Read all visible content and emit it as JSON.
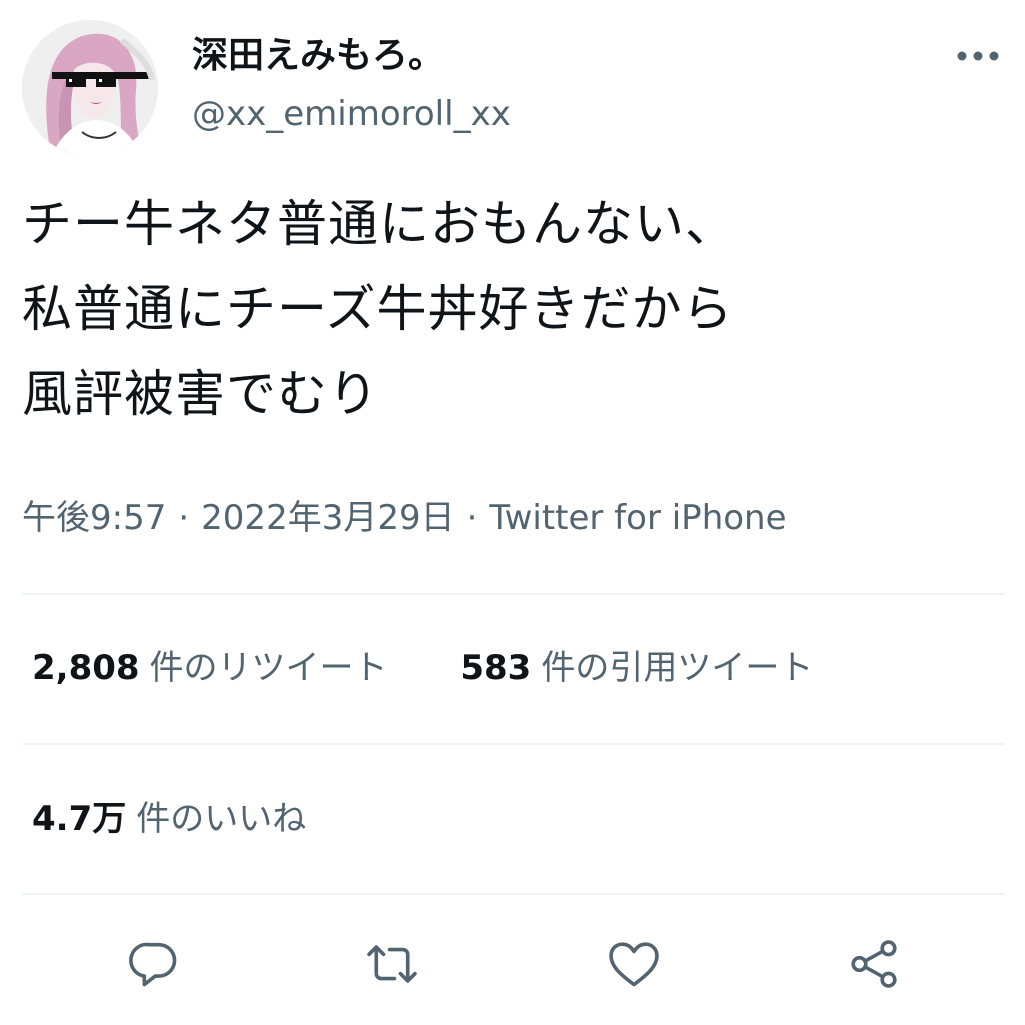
{
  "author": {
    "display_name": "深田えみもろ。",
    "handle": "@xx_emimoroll_xx",
    "avatar_icon": "profile-avatar"
  },
  "more_icon": "more-horizontal-icon",
  "tweet": {
    "lines": [
      "チー牛ネタ普通におもんない、",
      "私普通にチーズ牛丼好きだから",
      "風評被害でむり"
    ]
  },
  "meta": {
    "time": "午後9:57",
    "date": "2022年3月29日",
    "source": "Twitter for iPhone",
    "separator": "·"
  },
  "stats": {
    "retweets": {
      "count": "2,808",
      "label": "件のリツイート"
    },
    "quotes": {
      "count": "583",
      "label": "件の引用ツイート"
    },
    "likes": {
      "count": "4.7万",
      "label": "件のいいね"
    }
  },
  "actions": {
    "reply_icon": "reply-icon",
    "retweet_icon": "retweet-icon",
    "like_icon": "like-icon",
    "share_icon": "share-icon"
  },
  "colors": {
    "text_primary": "#0f1419",
    "text_secondary": "#536471",
    "divider": "#eff3f4"
  }
}
